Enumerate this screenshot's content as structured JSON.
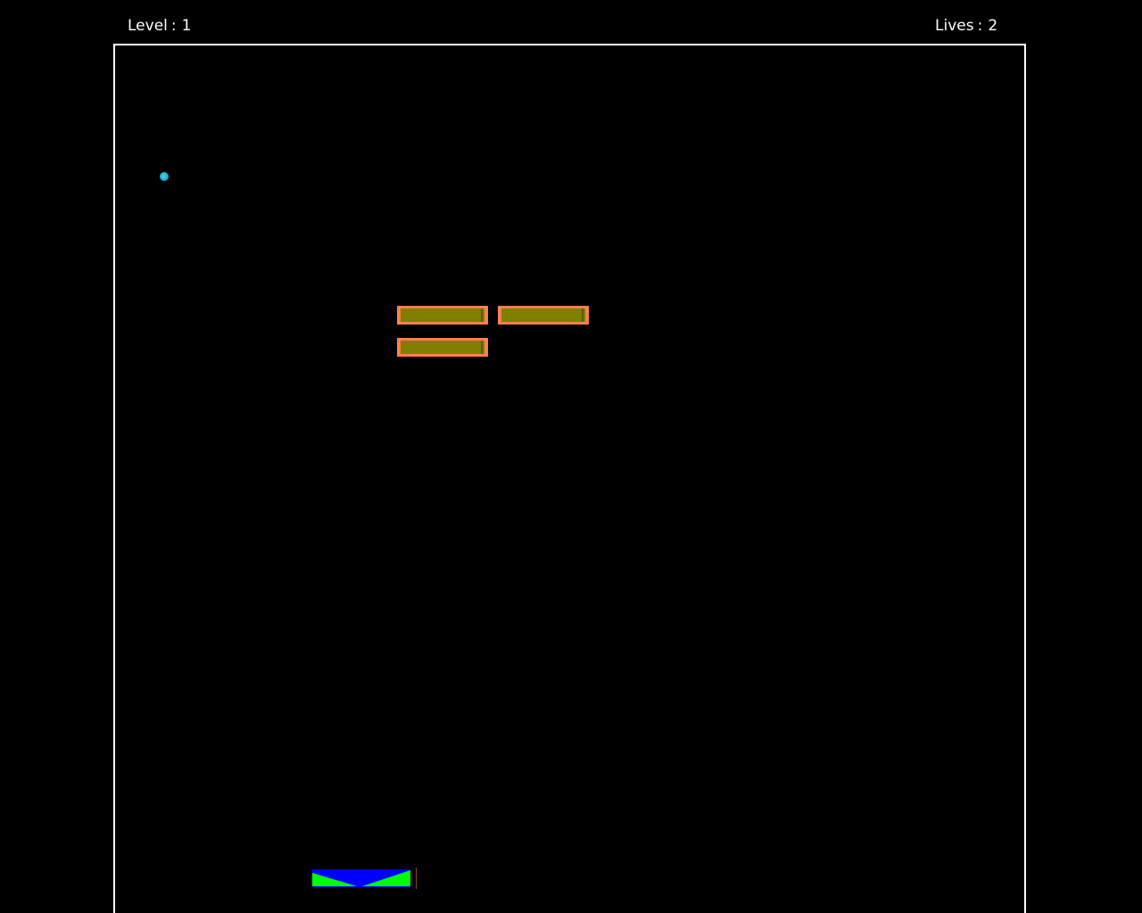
{
  "hud": {
    "level_label": "Level",
    "level_value": "1",
    "lives_label": "Lives",
    "lives_value": "2",
    "separator": ":"
  },
  "game": {
    "bricks_remaining": 3,
    "colors": {
      "background": "#000000",
      "border": "#ffffff",
      "brick_fill": "#7f7f00",
      "brick_border": "#ff7f50",
      "ball": "#1fb0c8",
      "paddle_blue": "#0000ff",
      "paddle_green": "#00ff00"
    }
  }
}
